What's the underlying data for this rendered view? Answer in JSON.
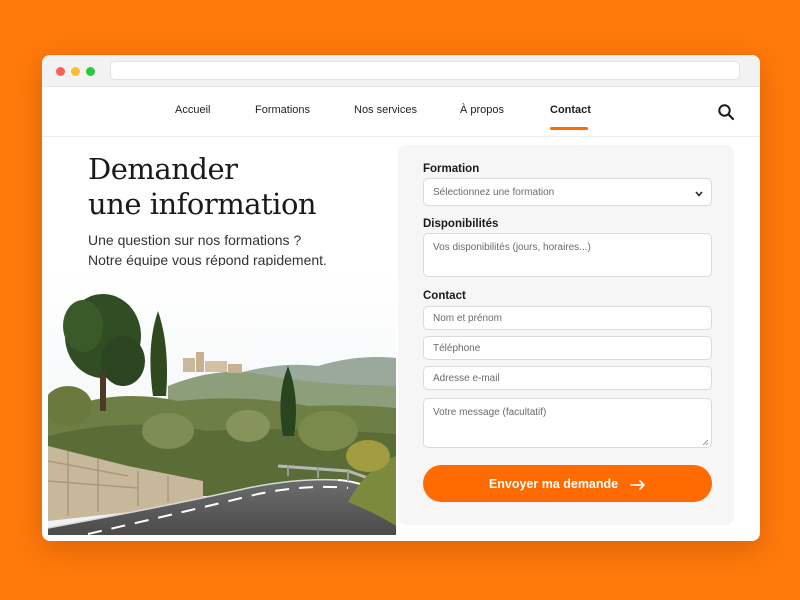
{
  "nav": {
    "items": [
      {
        "label": "Accueil"
      },
      {
        "label": "Formations"
      },
      {
        "label": "Nos services"
      },
      {
        "label": "À propos"
      },
      {
        "label": "Contact"
      }
    ],
    "active": "Contact",
    "search_icon": "search-icon"
  },
  "hero": {
    "heading_line1": "Demander",
    "heading_line2": "une information",
    "subtitle_line1": "Une question sur nos formations ?",
    "subtitle_line2": "Notre équipe vous répond rapidement."
  },
  "form": {
    "formation_label": "Formation",
    "formation_placeholder": "Sélectionnez une formation",
    "disponibilites_label": "Disponibilités",
    "disponibilites_placeholder": "Vos disponibilités (jours, horaires...)",
    "contact_label": "Contact",
    "name_placeholder": "Nom et prénom",
    "phone_placeholder": "Téléphone",
    "email_placeholder": "Adresse e-mail",
    "message_placeholder": "Votre message (facultatif)",
    "submit_label": "Envoyer ma demande"
  },
  "colors": {
    "background": "#FF7A0A",
    "accent": "#FF6B00"
  }
}
